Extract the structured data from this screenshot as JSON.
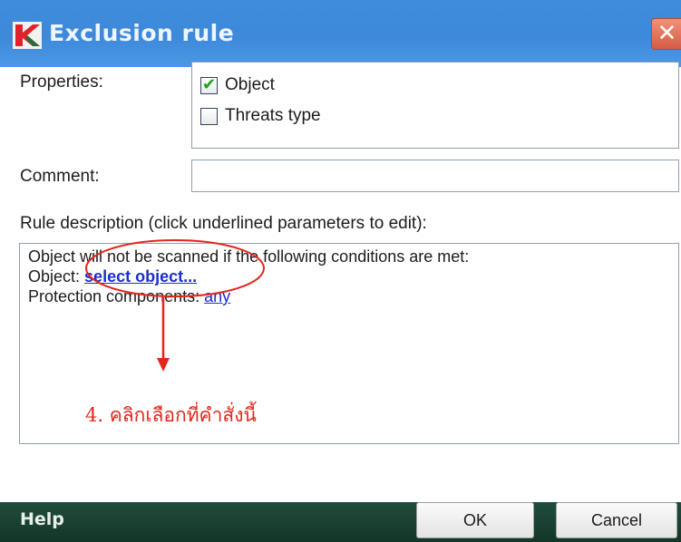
{
  "window": {
    "title": "Exclusion rule",
    "close_glyph": "✕"
  },
  "properties": {
    "label": "Properties:",
    "options": [
      {
        "label": "Object",
        "checked": true
      },
      {
        "label": "Threats type",
        "checked": false
      }
    ]
  },
  "comment": {
    "label": "Comment:",
    "value": "",
    "placeholder": ""
  },
  "rule_description": {
    "label": "Rule description (click underlined parameters to edit):",
    "condition_text": "Object will not be scanned if the following conditions are met:",
    "object_label": "Object:",
    "object_link": "select object...",
    "components_label": "Protection components:",
    "components_link": "any"
  },
  "annotation": {
    "text": "4. คลิกเลือกที่คำสั่งนี้",
    "color": "#e3261c"
  },
  "footer": {
    "help": "Help",
    "ok": "OK",
    "cancel": "Cancel"
  },
  "colors": {
    "titlebar": "#3e89da",
    "footer": "#1a4234",
    "link": "#1d2ecc"
  }
}
